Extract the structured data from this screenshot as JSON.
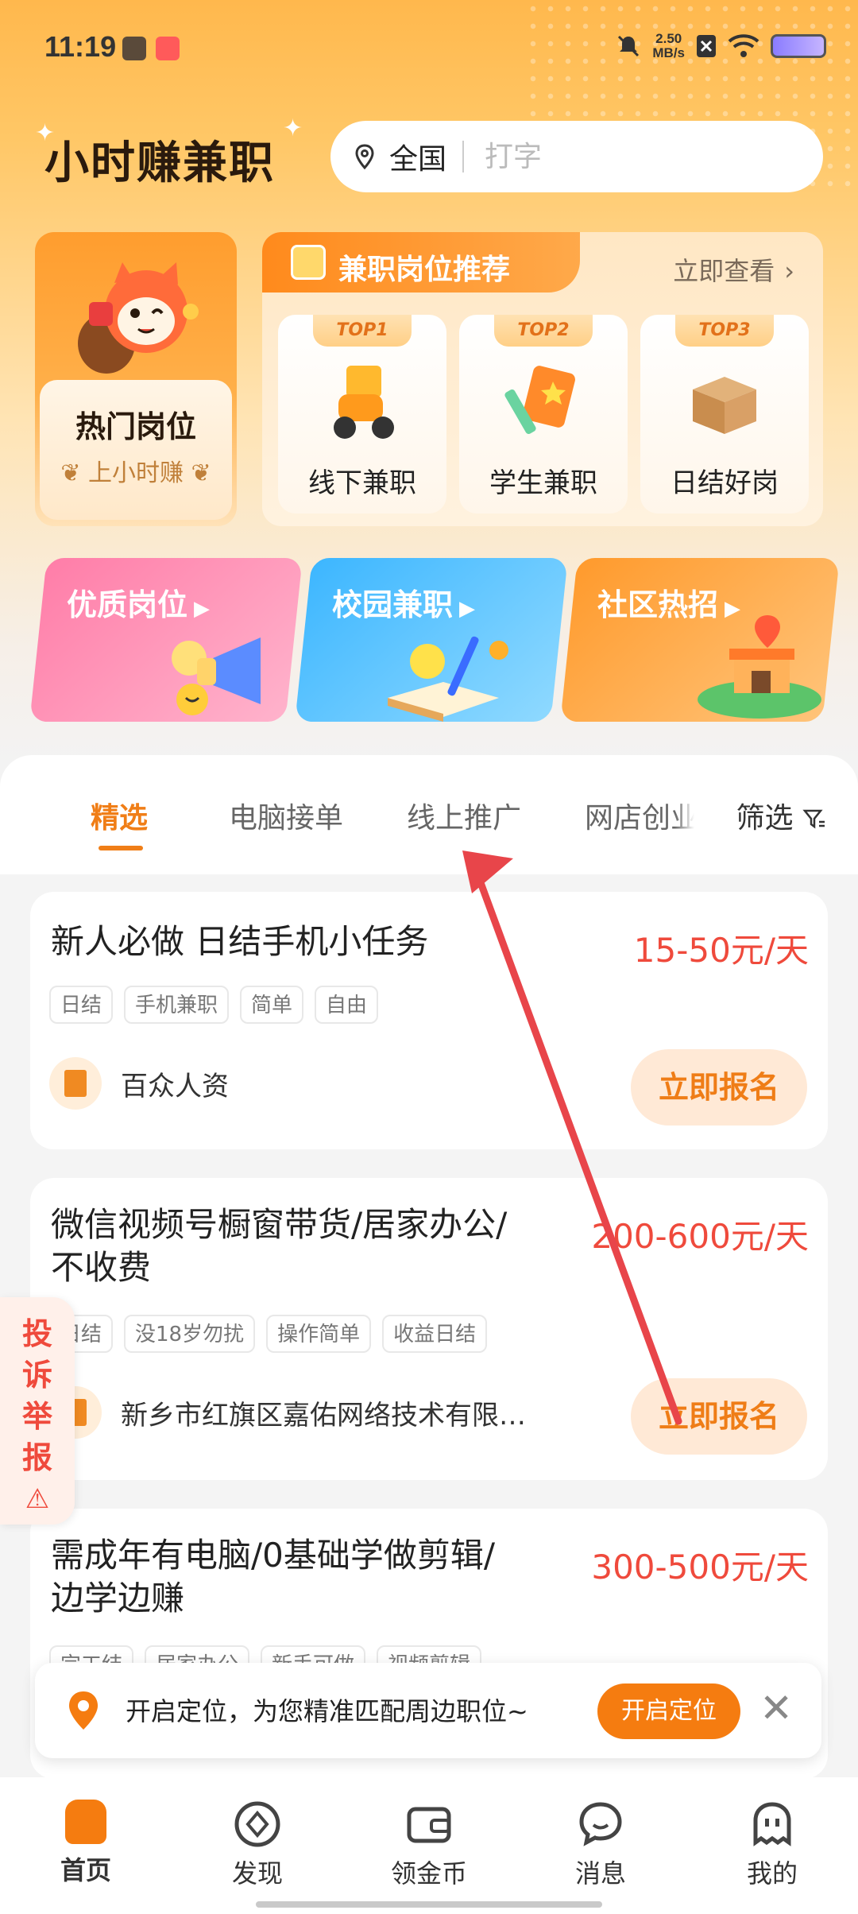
{
  "status_bar": {
    "time": "11:19",
    "net_speed_value": "2.50",
    "net_speed_unit": "MB/s"
  },
  "header": {
    "app_title": "小时赚兼职",
    "search": {
      "region": "全国",
      "placeholder": "打字"
    }
  },
  "hot_card": {
    "title": "热门岗位",
    "subtitle": "上小时赚"
  },
  "recommend": {
    "title": "兼职岗位推荐",
    "more": "立即查看",
    "items": [
      {
        "badge": "TOP1",
        "label": "线下兼职",
        "icon": "scooter-icon"
      },
      {
        "badge": "TOP2",
        "label": "学生兼职",
        "icon": "notebook-icon"
      },
      {
        "badge": "TOP3",
        "label": "日结好岗",
        "icon": "box-icon"
      }
    ]
  },
  "features": [
    {
      "title": "优质岗位"
    },
    {
      "title": "校园兼职"
    },
    {
      "title": "社区热招"
    }
  ],
  "tabs": {
    "items": [
      "精选",
      "电脑接单",
      "线上推广",
      "网店创业"
    ],
    "active": 0,
    "filter": "筛选"
  },
  "jobs": [
    {
      "title": "新人必做 日结手机小任务",
      "salary": "15-50元/天",
      "tags": [
        "日结",
        "手机兼职",
        "简单",
        "自由"
      ],
      "company": "百众人资",
      "apply": "立即报名"
    },
    {
      "title": "微信视频号橱窗带货/居家办公/不收费",
      "salary": "200-600元/天",
      "tags": [
        "日结",
        "没18岁勿扰",
        "操作简单",
        "收益日结"
      ],
      "company": "新乡市红旗区嘉佑网络技术有限…",
      "apply": "立即报名"
    },
    {
      "title": "需成年有电脑/0基础学做剪辑/边学边赚",
      "salary": "300-500元/天",
      "tags": [
        "完工结",
        "居家办公",
        "新手可做",
        "视频剪辑"
      ]
    }
  ],
  "complaint": {
    "chars": [
      "投",
      "诉",
      "举",
      "报"
    ]
  },
  "location_prompt": {
    "text": "开启定位，为您精准匹配周边职位~",
    "button": "开启定位"
  },
  "bottom_nav": [
    {
      "label": "首页",
      "icon": "home-icon"
    },
    {
      "label": "发现",
      "icon": "compass-icon"
    },
    {
      "label": "领金币",
      "icon": "wallet-icon"
    },
    {
      "label": "消息",
      "icon": "chat-icon"
    },
    {
      "label": "我的",
      "icon": "ghost-profile-icon"
    }
  ],
  "colors": {
    "accent": "#f07e17",
    "salary": "#ef4a3c",
    "annotation_arrow": "#e8454a"
  }
}
